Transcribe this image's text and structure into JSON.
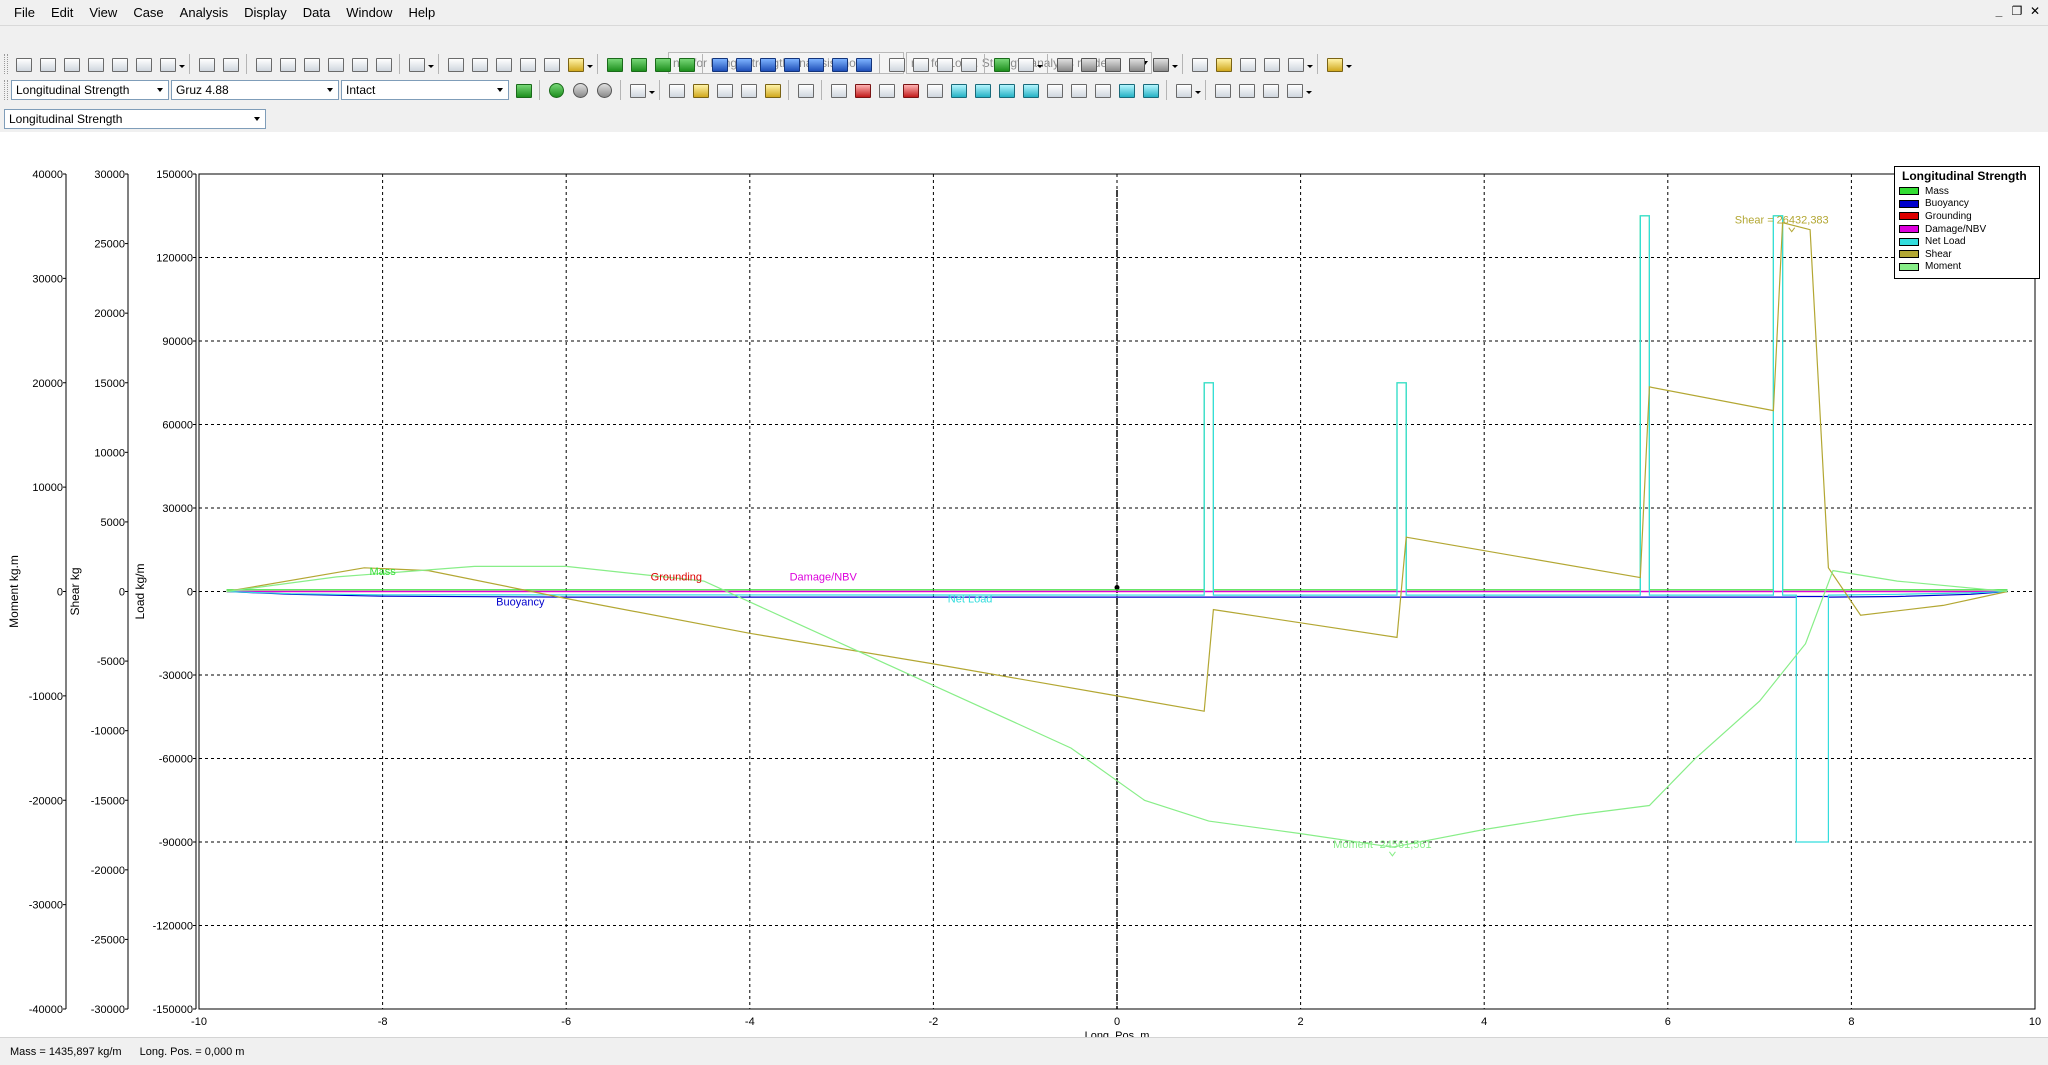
{
  "menu": [
    "File",
    "Edit",
    "View",
    "Case",
    "Analysis",
    "Display",
    "Data",
    "Window",
    "Help"
  ],
  "mdi_controls": [
    "_",
    "❐",
    "✕"
  ],
  "toolbar": {
    "mode_combo_1": "n/a for Long. Strength analysis mode",
    "mode_combo_2": "n/a for Long. Strength analysis mode",
    "analysis_type": "Longitudinal Strength",
    "loadcase": "Gruz 4.88",
    "damage_case": "Intact"
  },
  "view_selector": "Longitudinal Strength",
  "chart_data": {
    "type": "line",
    "title": "",
    "xlabel": "Long. Pos.  m",
    "xlim": [
      -10,
      10
    ],
    "x_ticks": [
      -10,
      -8,
      -6,
      -4,
      -2,
      0,
      2,
      4,
      6,
      8,
      10
    ],
    "axes": {
      "load": {
        "label": "Load  kg/m",
        "lim": [
          -150000,
          150000
        ],
        "ticks": [
          150000,
          120000,
          90000,
          60000,
          30000,
          0,
          -30000,
          -60000,
          -90000,
          -120000,
          -150000
        ]
      },
      "shear": {
        "label": "Shear  kg",
        "lim": [
          -30000,
          30000
        ],
        "ticks": [
          30000,
          25000,
          20000,
          15000,
          10000,
          5000,
          0,
          -5000,
          -10000,
          -15000,
          -20000,
          -25000,
          -30000
        ]
      },
      "moment": {
        "label": "Moment  kg.m",
        "lim": [
          -40000,
          40000
        ],
        "ticks": [
          40000,
          30000,
          20000,
          10000,
          0,
          -10000,
          -20000,
          -30000,
          -40000
        ]
      }
    },
    "grid": true,
    "legend_position": "top-right",
    "legend_title": "Longitudinal Strength",
    "series": [
      {
        "name": "Mass",
        "color": "#33dd33",
        "axis": "load",
        "label": "Mass",
        "points": [
          [
            -9.7,
            600
          ],
          [
            0.95,
            600
          ],
          [
            0.95,
            75000
          ],
          [
            1.05,
            75000
          ],
          [
            1.05,
            600
          ],
          [
            3.05,
            600
          ],
          [
            3.05,
            75000
          ],
          [
            3.15,
            75000
          ],
          [
            3.15,
            600
          ],
          [
            5.7,
            600
          ],
          [
            5.7,
            135000
          ],
          [
            5.8,
            135000
          ],
          [
            5.8,
            600
          ],
          [
            7.15,
            600
          ],
          [
            7.15,
            135000
          ],
          [
            7.25,
            135000
          ],
          [
            7.25,
            600
          ],
          [
            9.7,
            600
          ]
        ]
      },
      {
        "name": "Buoyancy",
        "color": "#0000cc",
        "axis": "load",
        "label": "Buoyancy",
        "points": [
          [
            -9.7,
            0
          ],
          [
            -9.0,
            -1000
          ],
          [
            -8.0,
            -1700
          ],
          [
            -6.0,
            -2000
          ],
          [
            0,
            -2000
          ],
          [
            6.0,
            -2000
          ],
          [
            7.4,
            -2000
          ],
          [
            7.4,
            -1800
          ],
          [
            7.75,
            -1800
          ],
          [
            7.75,
            -2000
          ],
          [
            8.5,
            -1800
          ],
          [
            9.3,
            -1000
          ],
          [
            9.7,
            0
          ]
        ]
      },
      {
        "name": "Grounding",
        "color": "#dd0000",
        "axis": "load",
        "label": "Grounding",
        "points": [
          [
            -9.7,
            0
          ],
          [
            9.7,
            0
          ]
        ]
      },
      {
        "name": "Damage/NBV",
        "color": "#dd00dd",
        "axis": "load",
        "label": "Damage/NBV",
        "points": [
          [
            -9.7,
            0
          ],
          [
            9.7,
            0
          ]
        ]
      },
      {
        "name": "Net Load",
        "color": "#33dddd",
        "axis": "load",
        "label": "Net Load",
        "points": [
          [
            -9.7,
            0
          ],
          [
            -9.0,
            -800
          ],
          [
            -8.0,
            -1200
          ],
          [
            0.95,
            -1300
          ],
          [
            0.95,
            75000
          ],
          [
            1.05,
            75000
          ],
          [
            1.05,
            -1300
          ],
          [
            3.05,
            -1300
          ],
          [
            3.05,
            75000
          ],
          [
            3.15,
            75000
          ],
          [
            3.15,
            -1300
          ],
          [
            5.7,
            -1300
          ],
          [
            5.7,
            135000
          ],
          [
            5.8,
            135000
          ],
          [
            5.8,
            -1300
          ],
          [
            7.15,
            -1300
          ],
          [
            7.15,
            135000
          ],
          [
            7.25,
            135000
          ],
          [
            7.25,
            -1300
          ],
          [
            7.4,
            -1300
          ],
          [
            7.4,
            -90000
          ],
          [
            7.75,
            -90000
          ],
          [
            7.75,
            -1300
          ],
          [
            8.5,
            -1000
          ],
          [
            9.3,
            -500
          ],
          [
            9.7,
            0
          ]
        ]
      },
      {
        "name": "Shear",
        "color": "#b3a733",
        "axis": "shear",
        "label": "Shear",
        "points": [
          [
            -9.7,
            0
          ],
          [
            -8.2,
            1700
          ],
          [
            -7.5,
            1500
          ],
          [
            -6.0,
            -500
          ],
          [
            -4.0,
            -3000
          ],
          [
            -2.0,
            -5200
          ],
          [
            0.0,
            -7500
          ],
          [
            0.95,
            -8600
          ],
          [
            1.05,
            -1300
          ],
          [
            3.05,
            -3300
          ],
          [
            3.15,
            3900
          ],
          [
            5.7,
            1000
          ],
          [
            5.8,
            14700
          ],
          [
            7.15,
            13000
          ],
          [
            7.25,
            26500
          ],
          [
            7.55,
            26000
          ],
          [
            7.75,
            1700
          ],
          [
            8.1,
            -1700
          ],
          [
            9.0,
            -1000
          ],
          [
            9.7,
            0
          ]
        ]
      },
      {
        "name": "Moment",
        "color": "#88ee88",
        "axis": "moment",
        "label": "Moment",
        "points": [
          [
            -9.7,
            0
          ],
          [
            -8.5,
            1400
          ],
          [
            -7.0,
            2400
          ],
          [
            -6.0,
            2400
          ],
          [
            -4.5,
            1000
          ],
          [
            -3.5,
            -3000
          ],
          [
            -2.0,
            -9000
          ],
          [
            -0.5,
            -15000
          ],
          [
            0.3,
            -20000
          ],
          [
            1.0,
            -22000
          ],
          [
            2.0,
            -23200
          ],
          [
            3.0,
            -24500
          ],
          [
            4.0,
            -22800
          ],
          [
            5.0,
            -21400
          ],
          [
            5.8,
            -20500
          ],
          [
            6.3,
            -16000
          ],
          [
            7.0,
            -10500
          ],
          [
            7.5,
            -5000
          ],
          [
            7.8,
            2000
          ],
          [
            8.5,
            1000
          ],
          [
            9.7,
            0
          ]
        ]
      }
    ],
    "annotations": [
      {
        "text": "Shear = 26432,383",
        "series": "Shear",
        "x": 7.35,
        "y": 26432
      },
      {
        "text": "Moment -24561,561",
        "series": "Moment",
        "x": 3.0,
        "y": -24561
      }
    ],
    "zero_marker_x": 0
  },
  "status": {
    "mass": "Mass =  1435,897 kg/m",
    "long_pos": "Long. Pos. =  0,000 m"
  }
}
